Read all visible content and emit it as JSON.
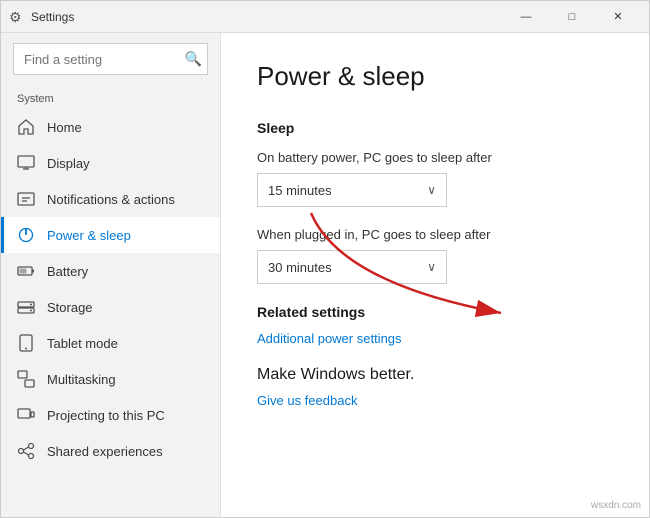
{
  "window": {
    "title": "Settings",
    "controls": {
      "minimize": "—",
      "maximize": "□",
      "close": "✕"
    }
  },
  "sidebar": {
    "search_placeholder": "Find a setting",
    "search_icon": "🔍",
    "section_label": "System",
    "items": [
      {
        "id": "home",
        "label": "Home",
        "active": false
      },
      {
        "id": "display",
        "label": "Display",
        "active": false
      },
      {
        "id": "notifications",
        "label": "Notifications & actions",
        "active": false
      },
      {
        "id": "power",
        "label": "Power & sleep",
        "active": true
      },
      {
        "id": "battery",
        "label": "Battery",
        "active": false
      },
      {
        "id": "storage",
        "label": "Storage",
        "active": false
      },
      {
        "id": "tablet",
        "label": "Tablet mode",
        "active": false
      },
      {
        "id": "multitasking",
        "label": "Multitasking",
        "active": false
      },
      {
        "id": "projecting",
        "label": "Projecting to this PC",
        "active": false
      },
      {
        "id": "shared",
        "label": "Shared experiences",
        "active": false
      }
    ]
  },
  "content": {
    "page_title": "Power & sleep",
    "sleep_section": {
      "title": "Sleep",
      "battery_label": "On battery power, PC goes to sleep after",
      "battery_value": "15 minutes",
      "plugged_label": "When plugged in, PC goes to sleep after",
      "plugged_value": "30 minutes"
    },
    "related_section": {
      "title": "Related settings",
      "link": "Additional power settings"
    },
    "feedback_section": {
      "title": "Make Windows better.",
      "link": "Give us feedback"
    }
  },
  "watermark": "wsxdn.com"
}
